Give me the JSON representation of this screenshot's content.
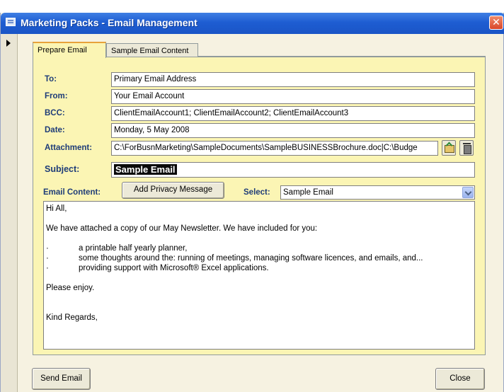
{
  "window": {
    "title": "Marketing Packs - Email Management"
  },
  "tabs": [
    {
      "label": "Prepare Email",
      "active": true
    },
    {
      "label": "Sample Email Content",
      "active": false
    }
  ],
  "fields": {
    "to": {
      "label": "To:",
      "value": "Primary Email Address"
    },
    "from": {
      "label": "From:",
      "value": "Your Email Account"
    },
    "bcc": {
      "label": "BCC:",
      "value": "ClientEmailAccount1; ClientEmailAccount2; ClientEmailAccount3"
    },
    "date": {
      "label": "Date:",
      "value": "Monday, 5 May 2008"
    },
    "attachment": {
      "label": "Attachment:",
      "value": "C:\\ForBusnMarketing\\SampleDocuments\\SampleBUSINESSBrochure.doc|C:\\Budge"
    },
    "subject": {
      "label": "Subject:",
      "value": "Sample Email"
    }
  },
  "email_content": {
    "label": "Email Content:",
    "privacy_button": "Add Privacy Message",
    "select_label": "Select:",
    "select_value": "Sample Email",
    "body": {
      "greeting": "Hi All,",
      "intro": "We have attached a copy of our May Newsletter.  We have included for you:",
      "bullet_char": "·",
      "bullets": [
        "a printable half yearly planner,",
        "some thoughts around the: running of meetings, managing software licences, and emails, and...",
        "providing support with Microsoft® Excel applications."
      ],
      "closing1": "Please enjoy.",
      "closing2": "Kind Regards,"
    }
  },
  "buttons": {
    "send": "Send Email",
    "close": "Close"
  },
  "colors": {
    "titlebar": "#1e5dd2",
    "panel": "#fbf5b4",
    "label": "#1e3c78"
  }
}
